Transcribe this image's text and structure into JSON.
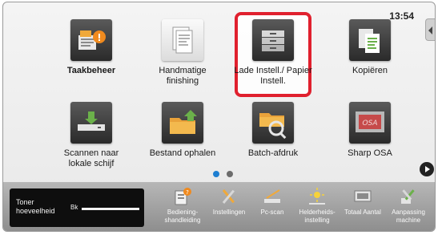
{
  "status": {
    "time": "13:54"
  },
  "home_tiles": [
    {
      "label": "Taakbeheer"
    },
    {
      "label": "Handmatige finishing"
    },
    {
      "label": "Lade Instell./ Papier Instell."
    },
    {
      "label": "Kopiëren"
    },
    {
      "label": "Scannen naar lokale schijf"
    },
    {
      "label": "Bestand ophalen"
    },
    {
      "label": "Batch-afdruk"
    },
    {
      "label": "Sharp OSA"
    }
  ],
  "pager": {
    "page_count": 2,
    "current_page": 1
  },
  "toner": {
    "label": "Toner hoeveelheid",
    "color": "Bk",
    "level": 1.0
  },
  "bottom_items": [
    {
      "label": "Bediening- shandleiding",
      "icon": "manual-icon"
    },
    {
      "label": "Instellingen",
      "icon": "settings-tools-icon"
    },
    {
      "label": "Pc-scan",
      "icon": "pc-scan-icon"
    },
    {
      "label": "Helderheids- instelling",
      "icon": "brightness-icon"
    },
    {
      "label": "Totaal Aantal",
      "icon": "counter-icon"
    },
    {
      "label": "Aanpassing machine",
      "icon": "machine-adjust-icon"
    }
  ],
  "colors": {
    "highlight": "#e0202e",
    "pager_active": "#1e7fd1"
  }
}
